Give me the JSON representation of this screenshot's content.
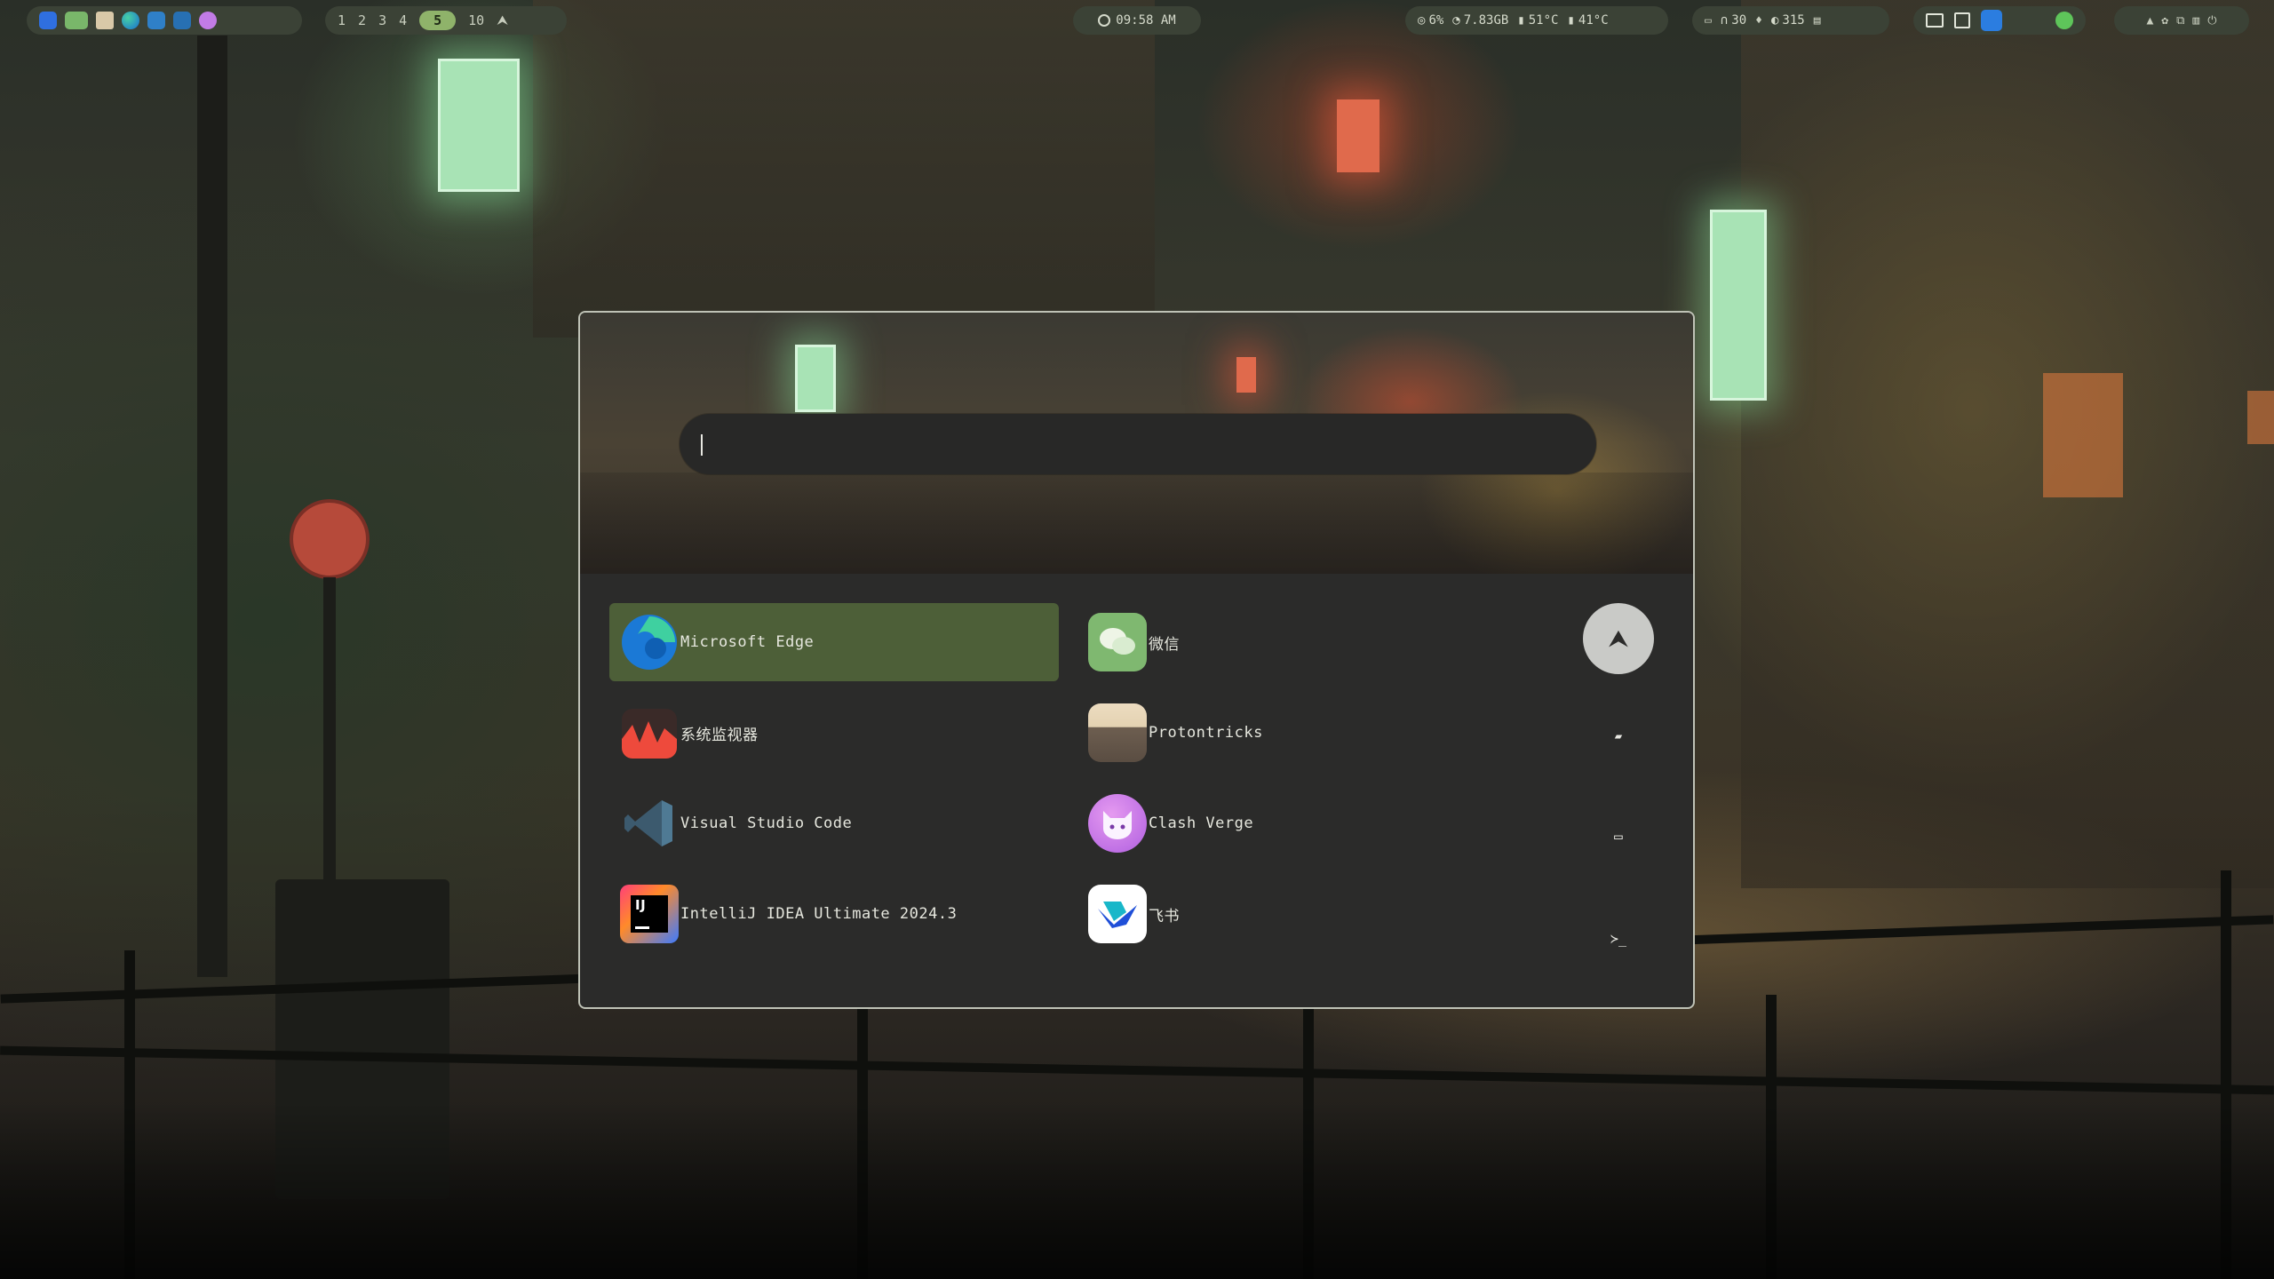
{
  "topbar": {
    "workspaces": [
      "1",
      "2",
      "3",
      "4",
      "5",
      "10"
    ],
    "active_workspace": "5",
    "launcher_glyph": "⮝",
    "clock": {
      "icon": "clock-icon",
      "time": "09:58 AM"
    },
    "system": {
      "cpu": "6%",
      "memory": "7.83GB",
      "temp_cpu": "51°C",
      "temp_gpu": "41°C"
    },
    "media": {
      "volume": "30",
      "brightness": "315"
    }
  },
  "launcher": {
    "search": {
      "value": "",
      "placeholder": ""
    },
    "apps": [
      {
        "label": "Microsoft Edge",
        "icon": "edge-icon",
        "selected": true
      },
      {
        "label": "微信",
        "icon": "wechat-icon",
        "selected": false
      },
      {
        "label": "系统监视器",
        "icon": "system-monitor-icon",
        "selected": false
      },
      {
        "label": "Protontricks",
        "icon": "protontricks-icon",
        "selected": false
      },
      {
        "label": "Visual Studio Code",
        "icon": "vscode-icon",
        "selected": false
      },
      {
        "label": "Clash Verge",
        "icon": "clash-verge-icon",
        "selected": false
      },
      {
        "label": "IntelliJ IDEA Ultimate 2024.3",
        "icon": "intellij-icon",
        "selected": false
      },
      {
        "label": "飞书",
        "icon": "feishu-icon",
        "selected": false
      }
    ],
    "side_buttons": {
      "apps_glyph": "⮝",
      "files_glyph": "▰",
      "windows_glyph": "▭",
      "terminal_glyph": "≻_"
    }
  },
  "colors": {
    "bar_pill": "#3b4236",
    "accent_green": "#8fb36a",
    "selected_row": "#4d5f38",
    "launcher_bg": "#2b2b2a"
  }
}
